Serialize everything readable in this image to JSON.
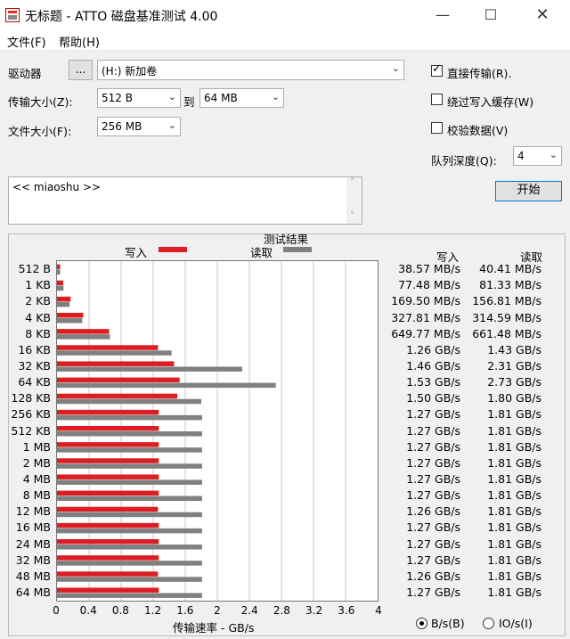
{
  "window": {
    "title": "无标题 - ATTO 磁盘基准测试 4.00"
  },
  "menu": [
    "文件(F)",
    "帮助(H)"
  ],
  "drive": {
    "label": "驱动器",
    "browse": "...",
    "value": "(H:) 新加卷"
  },
  "transfer": {
    "label": "传输大小(Z):",
    "from": "512 B",
    "to_label": "到",
    "to": "64 MB"
  },
  "filesize": {
    "label": "文件大小(F):",
    "value": "256 MB"
  },
  "options": {
    "direct_io": {
      "label": "直接传输(R).",
      "checked": true
    },
    "bypass_cache": {
      "label": "绕过写入缓存(W)",
      "checked": false
    },
    "verify": {
      "label": "校验数据(V)",
      "checked": false
    },
    "queue_label": "队列深度(Q):",
    "queue_value": "4"
  },
  "start_button": "开始",
  "description": "<< miaoshu >>",
  "results": {
    "title": "测试结果",
    "write_legend": "写入",
    "read_legend": "读取",
    "write_header": "写入",
    "read_header": "读取",
    "xaxis_title": "传输速率 - GB/s",
    "units": {
      "bs": "B/s(B)",
      "ios": "IO/s(I)",
      "selected": "bs"
    }
  },
  "chart_data": {
    "type": "bar",
    "orientation": "horizontal",
    "xlim": [
      0,
      4
    ],
    "xticks": [
      "0",
      "0.4",
      "0.8",
      "1.2",
      "1.6",
      "2",
      "2.4",
      "2.8",
      "3.2",
      "3.6",
      "4"
    ],
    "colors": {
      "write": "#dc1e24",
      "read": "#808080"
    },
    "categories": [
      "512 B",
      "1 KB",
      "2 KB",
      "4 KB",
      "8 KB",
      "16 KB",
      "32 KB",
      "64 KB",
      "128 KB",
      "256 KB",
      "512 KB",
      "1 MB",
      "2 MB",
      "4 MB",
      "8 MB",
      "12 MB",
      "16 MB",
      "24 MB",
      "32 MB",
      "48 MB",
      "64 MB"
    ],
    "series": [
      {
        "name": "写入",
        "values": [
          0.03857,
          0.07748,
          0.1695,
          0.32781,
          0.64977,
          1.26,
          1.46,
          1.53,
          1.5,
          1.27,
          1.27,
          1.27,
          1.27,
          1.27,
          1.27,
          1.26,
          1.27,
          1.27,
          1.27,
          1.26,
          1.27
        ],
        "labels": [
          "38.57 MB/s",
          "77.48 MB/s",
          "169.50 MB/s",
          "327.81 MB/s",
          "649.77 MB/s",
          "1.26 GB/s",
          "1.46 GB/s",
          "1.53 GB/s",
          "1.50 GB/s",
          "1.27 GB/s",
          "1.27 GB/s",
          "1.27 GB/s",
          "1.27 GB/s",
          "1.27 GB/s",
          "1.27 GB/s",
          "1.26 GB/s",
          "1.27 GB/s",
          "1.27 GB/s",
          "1.27 GB/s",
          "1.26 GB/s",
          "1.27 GB/s"
        ]
      },
      {
        "name": "读取",
        "values": [
          0.04041,
          0.08133,
          0.15681,
          0.31459,
          0.66148,
          1.43,
          2.31,
          2.73,
          1.8,
          1.81,
          1.81,
          1.81,
          1.81,
          1.81,
          1.81,
          1.81,
          1.81,
          1.81,
          1.81,
          1.81,
          1.81
        ],
        "labels": [
          "40.41 MB/s",
          "81.33 MB/s",
          "156.81 MB/s",
          "314.59 MB/s",
          "661.48 MB/s",
          "1.43 GB/s",
          "2.31 GB/s",
          "2.73 GB/s",
          "1.80 GB/s",
          "1.81 GB/s",
          "1.81 GB/s",
          "1.81 GB/s",
          "1.81 GB/s",
          "1.81 GB/s",
          "1.81 GB/s",
          "1.81 GB/s",
          "1.81 GB/s",
          "1.81 GB/s",
          "1.81 GB/s",
          "1.81 GB/s",
          "1.81 GB/s"
        ]
      }
    ]
  }
}
